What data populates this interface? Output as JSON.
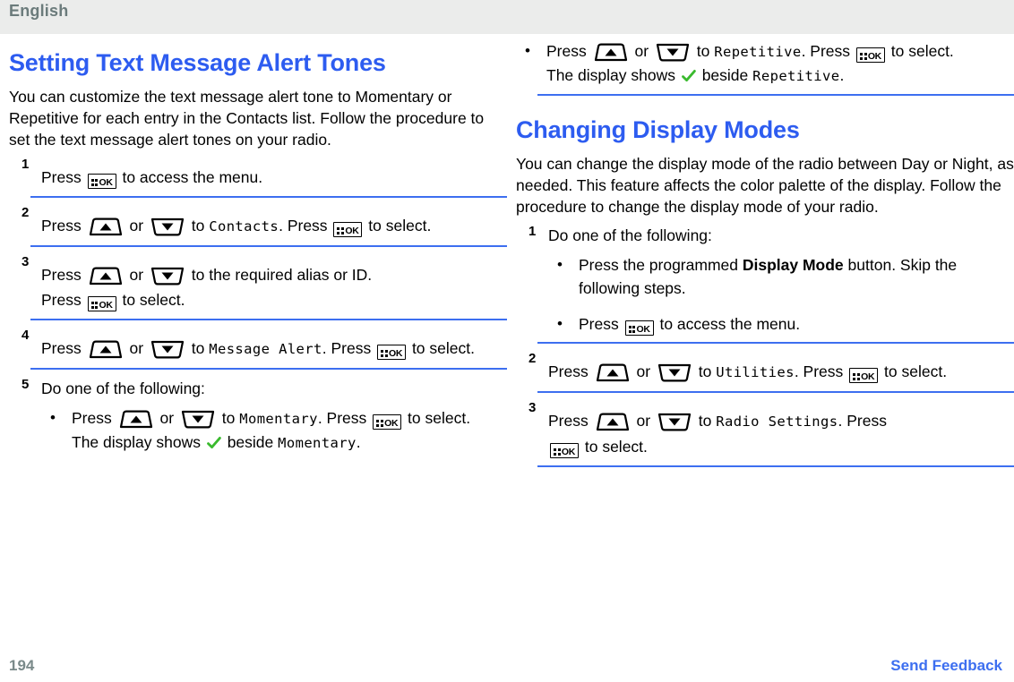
{
  "header": {
    "language": "English"
  },
  "footer": {
    "page_number": "194",
    "feedback_link": "Send Feedback"
  },
  "colors": {
    "heading_blue": "#2d5cf0",
    "rule_blue": "#3d6ff0",
    "header_band": "#ebeceb",
    "header_text": "#6b7b7b",
    "page_number": "#7a8a8a",
    "check_green": "#3aba2e"
  },
  "icons": {
    "ok_key": "menu-ok-key-icon",
    "up_key": "up-arrow-key-icon",
    "down_key": "down-arrow-key-icon",
    "check": "green-check-icon",
    "bullet": "•"
  },
  "left_column": {
    "title": "Setting Text Message Alert Tones",
    "intro": "You can customize the text message alert tone to Momentary or Repetitive for each entry in the Contacts list. Follow the procedure to set the text message alert tones on your radio.",
    "steps": [
      {
        "num": "1",
        "lines": [
          {
            "parts": [
              {
                "t": "text",
                "v": "Press "
              },
              {
                "t": "ok"
              },
              {
                "t": "text",
                "v": " to access the menu."
              }
            ]
          }
        ]
      },
      {
        "num": "2",
        "lines": [
          {
            "parts": [
              {
                "t": "text",
                "v": "Press "
              },
              {
                "t": "up"
              },
              {
                "t": "text",
                "v": " or "
              },
              {
                "t": "down"
              },
              {
                "t": "text",
                "v": " to "
              },
              {
                "t": "lcd",
                "v": "Contacts"
              },
              {
                "t": "text",
                "v": ". Press "
              },
              {
                "t": "ok"
              },
              {
                "t": "text",
                "v": " to select."
              }
            ]
          }
        ]
      },
      {
        "num": "3",
        "lines": [
          {
            "parts": [
              {
                "t": "text",
                "v": "Press "
              },
              {
                "t": "up"
              },
              {
                "t": "text",
                "v": " or "
              },
              {
                "t": "down"
              },
              {
                "t": "text",
                "v": " to the required alias or ID."
              }
            ]
          },
          {
            "parts": [
              {
                "t": "text",
                "v": "Press "
              },
              {
                "t": "ok"
              },
              {
                "t": "text",
                "v": " to select."
              }
            ]
          }
        ]
      },
      {
        "num": "4",
        "lines": [
          {
            "parts": [
              {
                "t": "text",
                "v": "Press "
              },
              {
                "t": "up"
              },
              {
                "t": "text",
                "v": " or "
              },
              {
                "t": "down"
              },
              {
                "t": "text",
                "v": " to "
              },
              {
                "t": "lcd",
                "v": "Message Alert"
              },
              {
                "t": "text",
                "v": ". Press "
              },
              {
                "t": "ok"
              },
              {
                "t": "text",
                "v": " to select."
              }
            ]
          }
        ]
      },
      {
        "num": "5",
        "label": "Do one of the following:",
        "bullets": [
          {
            "parts": [
              {
                "t": "text",
                "v": "Press "
              },
              {
                "t": "up"
              },
              {
                "t": "text",
                "v": " or "
              },
              {
                "t": "down"
              },
              {
                "t": "text",
                "v": " to "
              },
              {
                "t": "lcd",
                "v": "Momentary"
              },
              {
                "t": "text",
                "v": ". Press "
              },
              {
                "t": "ok"
              },
              {
                "t": "text",
                "v": " to select."
              },
              {
                "t": "br"
              },
              {
                "t": "text",
                "v": "The display shows "
              },
              {
                "t": "check"
              },
              {
                "t": "text",
                "v": " beside "
              },
              {
                "t": "lcd",
                "v": "Momentary"
              },
              {
                "t": "text",
                "v": "."
              }
            ]
          }
        ]
      }
    ]
  },
  "right_column": {
    "continued_bullets": [
      {
        "parts": [
          {
            "t": "text",
            "v": "Press "
          },
          {
            "t": "up"
          },
          {
            "t": "text",
            "v": " or "
          },
          {
            "t": "down"
          },
          {
            "t": "text",
            "v": " to "
          },
          {
            "t": "lcd",
            "v": "Repetitive"
          },
          {
            "t": "text",
            "v": ". Press "
          },
          {
            "t": "ok"
          },
          {
            "t": "text",
            "v": " to select."
          },
          {
            "t": "br"
          },
          {
            "t": "text",
            "v": "The display shows "
          },
          {
            "t": "check"
          },
          {
            "t": "text",
            "v": " beside "
          },
          {
            "t": "lcd",
            "v": "Repetitive"
          },
          {
            "t": "text",
            "v": "."
          }
        ]
      }
    ],
    "title": "Changing Display Modes",
    "intro": "You can change the display mode of the radio between Day or Night, as needed. This feature affects the color palette of the display. Follow the procedure to change the display mode of your radio.",
    "steps": [
      {
        "num": "1",
        "label": "Do one of the following:",
        "bullets": [
          {
            "parts": [
              {
                "t": "text",
                "v": "Press the programmed "
              },
              {
                "t": "bold",
                "v": "Display Mode"
              },
              {
                "t": "text",
                "v": " button. Skip the following steps."
              }
            ]
          },
          {
            "parts": [
              {
                "t": "text",
                "v": "Press "
              },
              {
                "t": "ok"
              },
              {
                "t": "text",
                "v": " to access the menu."
              }
            ]
          }
        ]
      },
      {
        "num": "2",
        "lines": [
          {
            "parts": [
              {
                "t": "text",
                "v": "Press "
              },
              {
                "t": "up"
              },
              {
                "t": "text",
                "v": " or "
              },
              {
                "t": "down"
              },
              {
                "t": "text",
                "v": " to "
              },
              {
                "t": "lcd",
                "v": "Utilities"
              },
              {
                "t": "text",
                "v": ". Press "
              },
              {
                "t": "ok"
              },
              {
                "t": "text",
                "v": " to select."
              }
            ]
          }
        ]
      },
      {
        "num": "3",
        "lines": [
          {
            "parts": [
              {
                "t": "text",
                "v": "Press "
              },
              {
                "t": "up"
              },
              {
                "t": "text",
                "v": " or "
              },
              {
                "t": "down"
              },
              {
                "t": "text",
                "v": " to "
              },
              {
                "t": "lcd",
                "v": "Radio Settings"
              },
              {
                "t": "text",
                "v": ". Press "
              }
            ]
          },
          {
            "parts": [
              {
                "t": "ok"
              },
              {
                "t": "text",
                "v": " to select."
              }
            ]
          }
        ]
      }
    ]
  }
}
